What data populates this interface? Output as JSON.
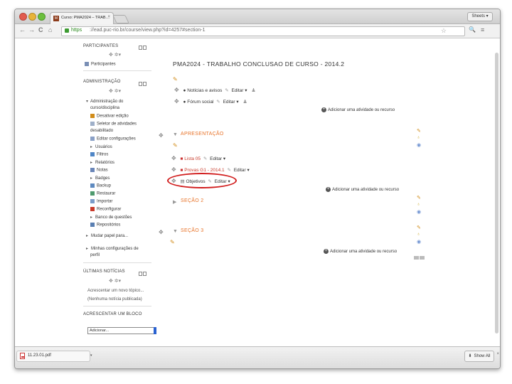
{
  "browser": {
    "tab_title": "Curso: PMA2024 – TRAB…",
    "tab_close": "×",
    "favicon": "M",
    "profile": "Sheets ▾",
    "url_scheme": "https",
    "url_rest": "://ead.puc-rio.br/course/view.php?id=4257#section-1",
    "nav": {
      "back": "←",
      "forward": "→",
      "reload": "C",
      "home": "⌂",
      "star": "☆",
      "zoom": "🔍",
      "menu": "≡"
    }
  },
  "sidebar": {
    "participants": {
      "title": "PARTICIPANTES",
      "move": "✥ ✲▾",
      "item": "Participantes"
    },
    "admin": {
      "title": "ADMINISTRAÇÃO",
      "move": "✥ ✲▾",
      "items": [
        "Administração do",
        "curso/disciplina",
        "Desativar edição",
        "Seletor de atividades",
        "desabilitado",
        "Editar configurações",
        "Usuários",
        "Filtros",
        "Relatórios",
        "Notas",
        "Badges",
        "Backup",
        "Restaurar",
        "Importar",
        "Reconfigurar",
        "Banco de questões",
        "Repositórios",
        "Mudar papel para...",
        "Minhas configurações de",
        "perfil"
      ]
    },
    "news": {
      "title": "ÚLTIMAS NOTÍCIAS",
      "move": "✥ ✲▾",
      "add": "Acrescentar um novo tópico...",
      "none": "(Nenhuma notícia publicada)"
    },
    "blog": {
      "title": "ACRESCENTAR UM BLOCO",
      "select": "Adicionar..."
    }
  },
  "course": {
    "title": "PMA2024 - TRABALHO CONCLUSAO DE CURSO - 2014.2",
    "edit_label": "Editar ▾",
    "add_resource": "Adicionar uma atividade ou recurso",
    "top_items": [
      {
        "label": "Notícias e avisos"
      },
      {
        "label": "Fórum social"
      }
    ],
    "sections": [
      {
        "title": "APRESENTAÇÃO",
        "items": [
          "Lista 05",
          "Provas G1 - 2014.1",
          "Objetivos"
        ]
      },
      {
        "title": "SEÇÃO 2"
      },
      {
        "title": "SEÇÃO 3"
      }
    ]
  },
  "downloads": {
    "file": "11.23.01.pdf",
    "show_all": "Show All",
    "close": "×",
    "caret": "▾"
  },
  "colors": {
    "accent_orange": "#e8742a",
    "highlight_red": "#d11c1c",
    "pencil": "#d18c1a"
  }
}
